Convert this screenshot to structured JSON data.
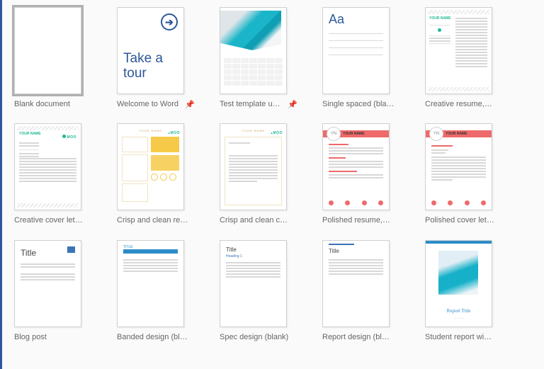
{
  "templates": [
    {
      "label": "Blank document"
    },
    {
      "label": "Welcome to Word",
      "pin": true,
      "take": "Take a\ntour"
    },
    {
      "label": "Test template use…",
      "pin": true
    },
    {
      "label": "Single spaced (bla…",
      "aa": "Aa"
    },
    {
      "label": "Creative resume,…",
      "name": "YOUR NAME"
    },
    {
      "label": "Creative cover let…",
      "name": "YOUR NAME",
      "moo": "MOO"
    },
    {
      "label": "Crisp and clean re…",
      "name": "YOUR NAME",
      "moo": "MOO"
    },
    {
      "label": "Crisp and clean c…",
      "name": "YOUR NAME",
      "moo": "MOO"
    },
    {
      "label": "Polished resume,…",
      "yn": "YN",
      "name": "YOUR NAME"
    },
    {
      "label": "Polished cover let…",
      "yn": "YN",
      "name": "YOUR NAME"
    },
    {
      "label": "Blog post",
      "title": "Title"
    },
    {
      "label": "Banded design (bl…",
      "title": "TITLE"
    },
    {
      "label": "Spec design (blank)",
      "title": "Title",
      "sub": "Heading 1"
    },
    {
      "label": "Report design (bl…",
      "title": "Title"
    },
    {
      "label": "Student report wi…",
      "cap": "Report Title"
    }
  ]
}
